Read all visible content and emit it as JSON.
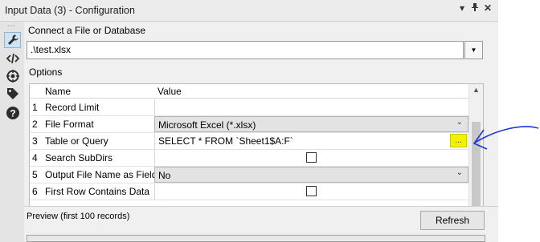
{
  "window": {
    "title": "Input Data (3) - Configuration",
    "controls": [
      "chevron-down-icon",
      "pin-icon",
      "close-icon"
    ]
  },
  "toolbar": {
    "tools": [
      {
        "name": "wrench-icon",
        "active": true
      },
      {
        "name": "code-icon",
        "active": false
      },
      {
        "name": "target-icon",
        "active": false
      },
      {
        "name": "tag-icon",
        "active": false
      },
      {
        "name": "help-icon",
        "active": false
      }
    ]
  },
  "connection": {
    "label": "Connect a File or Database",
    "value": ".\\test.xlsx"
  },
  "options": {
    "label": "Options",
    "columns": [
      "Name",
      "Value"
    ],
    "rows": [
      {
        "num": "1",
        "name": "Record Limit",
        "value": ""
      },
      {
        "num": "2",
        "name": "File Format",
        "value": "Microsoft Excel (*.xlsx)"
      },
      {
        "num": "3",
        "name": "Table or Query",
        "value": "SELECT * FROM `Sheet1$A:F`",
        "button": "..."
      },
      {
        "num": "4",
        "name": "Search SubDirs",
        "checked": false
      },
      {
        "num": "5",
        "name": "Output File Name as Field",
        "value": "No"
      },
      {
        "num": "6",
        "name": "First Row Contains Data",
        "checked": false
      }
    ]
  },
  "preview": {
    "label": "Preview (first 100 records)",
    "refresh_label": "Refresh"
  },
  "colors": {
    "highlight": "#f2f200",
    "annotation": "#1c36d8",
    "active_tool": "#cfe3f6"
  }
}
